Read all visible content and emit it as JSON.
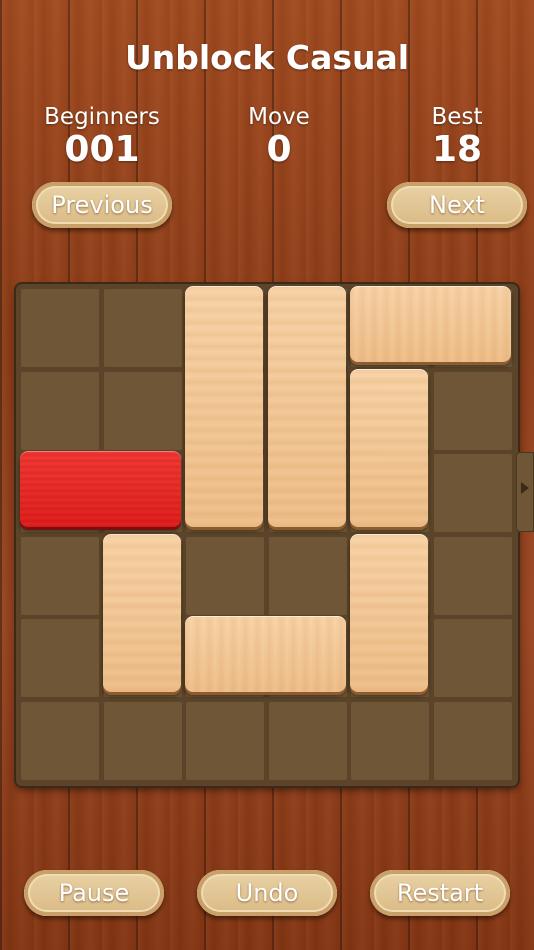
{
  "header": {
    "title": "Unblock Casual"
  },
  "stats": {
    "level": {
      "label": "Beginners",
      "value": "001"
    },
    "move": {
      "label": "Move",
      "value": "0"
    },
    "best": {
      "label": "Best",
      "value": "18"
    }
  },
  "nav": {
    "previous_label": "Previous",
    "next_label": "Next"
  },
  "board": {
    "size": 6,
    "blocks": [
      {
        "name": "target-red-block",
        "type": "red",
        "orientation": "horizontal",
        "row": 2,
        "col": 0,
        "length": 2
      },
      {
        "name": "wood-block-v-1",
        "type": "wood",
        "orientation": "vertical",
        "row": 0,
        "col": 2,
        "length": 3
      },
      {
        "name": "wood-block-v-2",
        "type": "wood",
        "orientation": "vertical",
        "row": 0,
        "col": 3,
        "length": 3
      },
      {
        "name": "wood-block-h-1",
        "type": "wood",
        "orientation": "horizontal",
        "row": 0,
        "col": 4,
        "length": 2
      },
      {
        "name": "wood-block-v-3",
        "type": "wood",
        "orientation": "vertical",
        "row": 1,
        "col": 4,
        "length": 2
      },
      {
        "name": "wood-block-v-4",
        "type": "wood",
        "orientation": "vertical",
        "row": 3,
        "col": 1,
        "length": 2
      },
      {
        "name": "wood-block-h-2",
        "type": "wood",
        "orientation": "horizontal",
        "row": 4,
        "col": 2,
        "length": 2
      },
      {
        "name": "wood-block-v-5",
        "type": "wood",
        "orientation": "vertical",
        "row": 3,
        "col": 4,
        "length": 2
      }
    ],
    "exit_row": 2
  },
  "controls": {
    "pause_label": "Pause",
    "undo_label": "Undo",
    "restart_label": "Restart"
  }
}
